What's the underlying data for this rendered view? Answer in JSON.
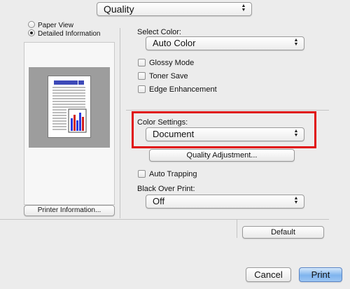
{
  "pane_selector": {
    "value": "Quality"
  },
  "view": {
    "paper_view": "Paper View",
    "detailed_information": "Detailed Information"
  },
  "printer_info_button": "Printer Information...",
  "select_color": {
    "label": "Select Color:",
    "value": "Auto Color"
  },
  "checkboxes": {
    "glossy_mode": "Glossy Mode",
    "toner_save": "Toner Save",
    "edge_enhancement": "Edge Enhancement",
    "auto_trapping": "Auto Trapping"
  },
  "color_settings": {
    "label": "Color Settings:",
    "value": "Document"
  },
  "quality_adjustment_button": "Quality Adjustment...",
  "black_over_print": {
    "label": "Black Over Print:",
    "value": "Off"
  },
  "default_button": "Default",
  "cancel_button": "Cancel",
  "print_button": "Print",
  "colors": {
    "highlight": "#e01010",
    "primary_button": "#7fb4ee"
  }
}
